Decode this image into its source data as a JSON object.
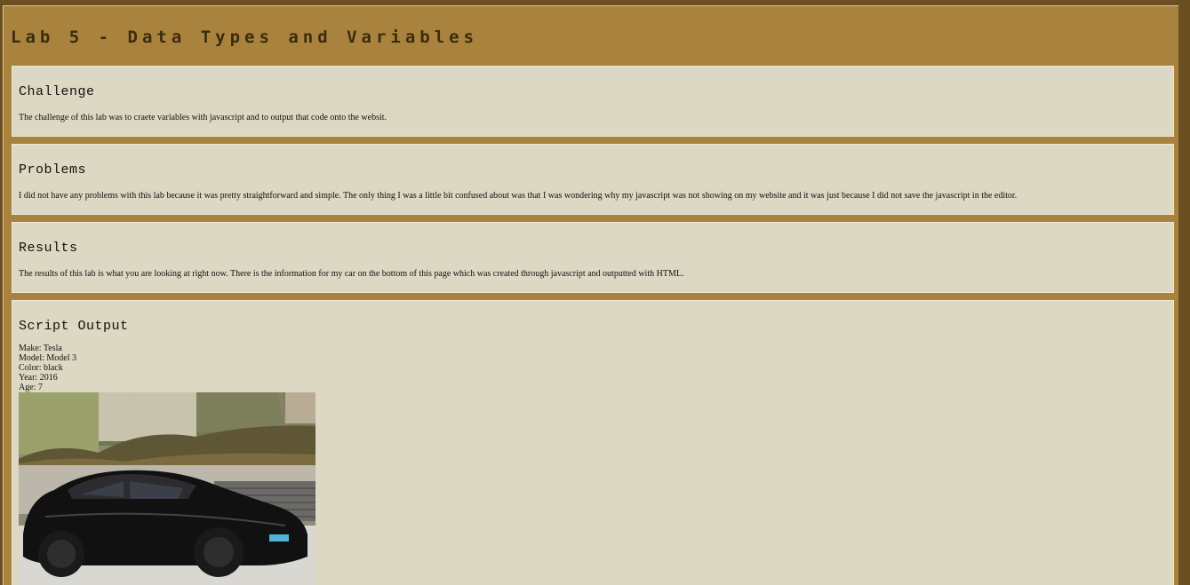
{
  "page": {
    "title": "Lab 5 - Data Types and Variables"
  },
  "sections": {
    "challenge": {
      "heading": "Challenge",
      "body": "The challenge of this lab was to craete variables with javascript and to output that code onto the websit."
    },
    "problems": {
      "heading": "Problems",
      "body": "I did not have any problems with this lab because it was pretty straightforward and simple. The only thing I was a little bit confused about was that I was wondering why my javascript was not showing on my website and it was just because I did not save the javascript in the editor."
    },
    "results": {
      "heading": "Results",
      "body": "The results of this lab is what you are looking at right now. There is the information for my car on the bottom of this page which was created through javascript and outputted with HTML."
    },
    "output": {
      "heading": "Script Output",
      "lines": {
        "make": "Make: Tesla",
        "model": "Model: Model 3",
        "color": "Color: black",
        "year": "Year: 2016",
        "age": "Age: 7"
      },
      "image": {
        "subject": "black Tesla Model 3 photo"
      }
    }
  },
  "colors": {
    "page_background": "#a9833d",
    "outer_background": "#6b4f22",
    "card_background": "#ddd8c3",
    "title_text": "#3c2c0d"
  }
}
